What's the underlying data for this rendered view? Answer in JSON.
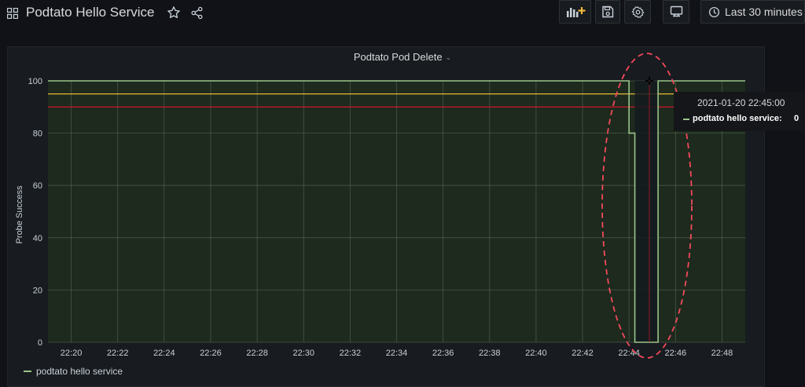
{
  "header": {
    "title": "Podtato Hello Service",
    "time_range": "Last 30 minutes",
    "icons": [
      "apps-icon",
      "star-icon",
      "share-icon",
      "add-panel-icon",
      "save-icon",
      "gear-icon",
      "tv-icon",
      "clock-icon"
    ]
  },
  "panel": {
    "title": "Podtato Pod Delete"
  },
  "tooltip": {
    "time": "2021-01-20 22:45:00",
    "series": "podtato hello service:",
    "value": "0"
  },
  "legend": {
    "label": "podtato hello service"
  },
  "colors": {
    "series": "#9ac48a",
    "threshold_warning": "#eab839",
    "threshold_critical": "#c4162a",
    "annotation_circle": "#f2495c",
    "background": "#111217",
    "panel": "#181b1f",
    "plot_area": "#1d2a1d"
  },
  "chart_data": {
    "type": "line",
    "title": "Podtato Pod Delete",
    "ylabel": "Probe Success",
    "xlabel": "",
    "ylim": [
      0,
      100
    ],
    "y_ticks": [
      "0",
      "20",
      "40",
      "60",
      "80",
      "100"
    ],
    "x_ticks": [
      "22:20",
      "22:22",
      "22:24",
      "22:26",
      "22:28",
      "22:30",
      "22:32",
      "22:34",
      "22:36",
      "22:38",
      "22:40",
      "22:42",
      "22:44",
      "22:46",
      "22:48"
    ],
    "x_range": [
      "22:19",
      "22:49"
    ],
    "grid": true,
    "legend_position": "bottom-left",
    "series": [
      {
        "name": "podtato hello service",
        "color": "#9ac48a",
        "points": [
          [
            "22:19",
            100
          ],
          [
            "22:44",
            100
          ],
          [
            "22:44",
            80
          ],
          [
            "22:44.25",
            80
          ],
          [
            "22:44.25",
            0
          ],
          [
            "22:45.25",
            0
          ],
          [
            "22:45.25",
            100
          ],
          [
            "22:49",
            100
          ]
        ]
      }
    ],
    "thresholds": [
      {
        "value": 95,
        "color": "#eab839"
      },
      {
        "value": 90,
        "color": "#c4162a"
      }
    ],
    "thresholds_end": "22:46"
  }
}
